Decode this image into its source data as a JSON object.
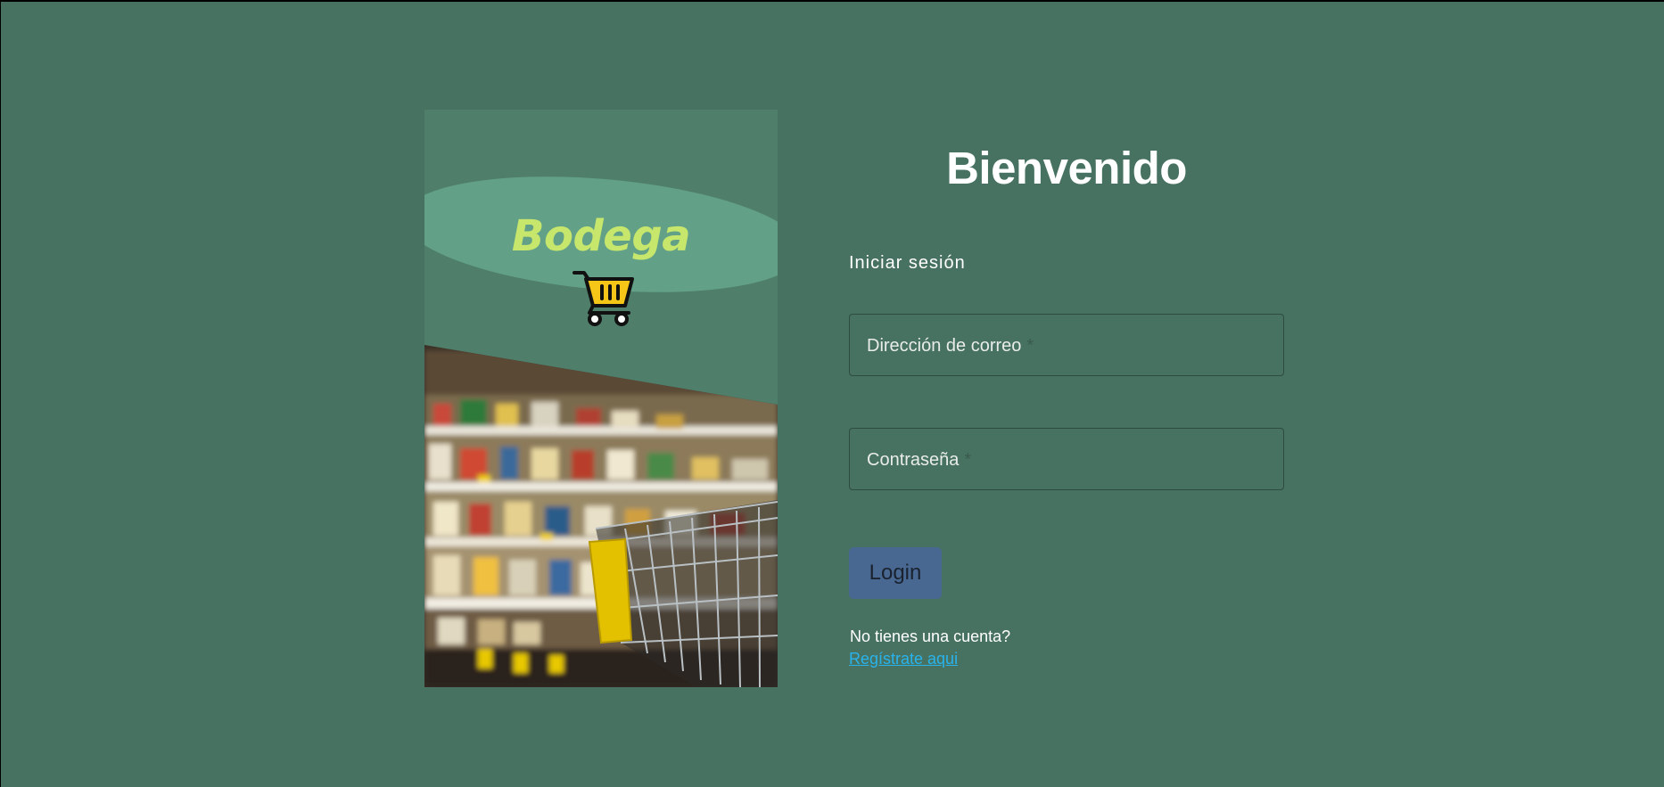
{
  "brand": {
    "name": "Bodega",
    "title_color": "#c6e66c",
    "panel_color": "#4f7e6b",
    "ellipse_color": "#62a087",
    "cart_icon": "shopping-cart-icon",
    "cart_color": "#f5c518"
  },
  "form": {
    "welcome": "Bienvenido",
    "subtitle": "Iniciar sesión",
    "email": {
      "label": "Dirección de correo",
      "required_mark": "*",
      "value": ""
    },
    "password": {
      "label": "Contraseña",
      "required_mark": "*",
      "value": ""
    },
    "login_label": "Login",
    "no_account_text": "No tienes una cuenta?",
    "register_link": "Regístrate aqui"
  },
  "colors": {
    "background": "#477261",
    "button": "#486891",
    "link": "#29b3ec",
    "text": "#ffffff"
  }
}
